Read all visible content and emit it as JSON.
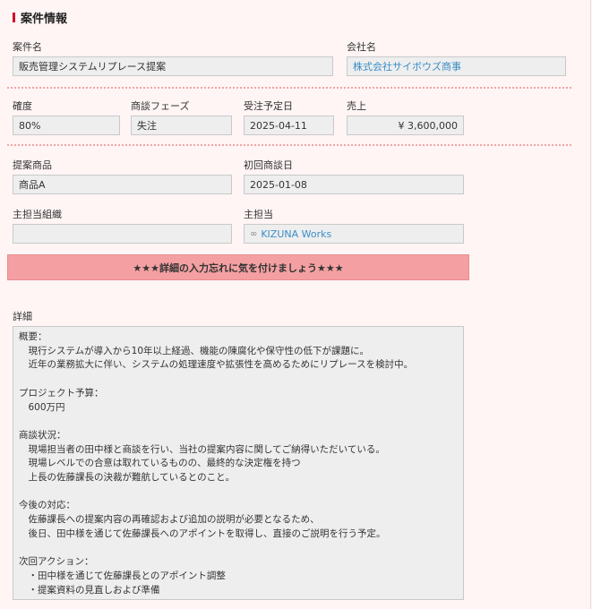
{
  "section": {
    "title": "案件情報"
  },
  "fields": {
    "project_name": {
      "label": "案件名",
      "value": "販売管理システムリプレース提案"
    },
    "company": {
      "label": "会社名",
      "value": "株式会社サイボウズ商事"
    },
    "probability": {
      "label": "確度",
      "value": "80%"
    },
    "phase": {
      "label": "商談フェーズ",
      "value": "失注"
    },
    "order_date": {
      "label": "受注予定日",
      "value": "2025-04-11"
    },
    "sales": {
      "label": "売上",
      "value": "¥ 3,600,000"
    },
    "product": {
      "label": "提案商品",
      "value": "商品A"
    },
    "first_meeting": {
      "label": "初回商談日",
      "value": "2025-01-08"
    },
    "org": {
      "label": "主担当組織",
      "value": ""
    },
    "owner": {
      "label": "主担当",
      "value": "KIZUNA Works"
    }
  },
  "banner": {
    "text": "★★★詳細の入力忘れに気を付けましょう★★★"
  },
  "detail": {
    "label": "詳細",
    "lines": [
      "概要：",
      "　現行システムが導入から10年以上経過、機能の陳腐化や保守性の低下が課題に。",
      "　近年の業務拡大に伴い、システムの処理速度や拡張性を高めるためにリプレースを検討中。",
      "",
      "プロジェクト予算：",
      "　600万円",
      "",
      "商談状況：",
      "　現場担当者の田中様と商談を行い、当社の提案内容に関してご納得いただいている。",
      "　現場レベルでの合意は取れているものの、最終的な決定権を持つ",
      "　上長の佐藤課長の決裁が難航しているとのこと。",
      "",
      "今後の対応：",
      "　佐藤課長への提案内容の再確認および追加の説明が必要となるため、",
      "　後日、田中様を通じて佐藤課長へのアポイントを取得し、直接のご説明を行う予定。",
      "",
      "次回アクション：",
      "　・田中様を通じて佐藤課長とのアポイント調整",
      "　・提案資料の見直しおよび準備"
    ]
  }
}
